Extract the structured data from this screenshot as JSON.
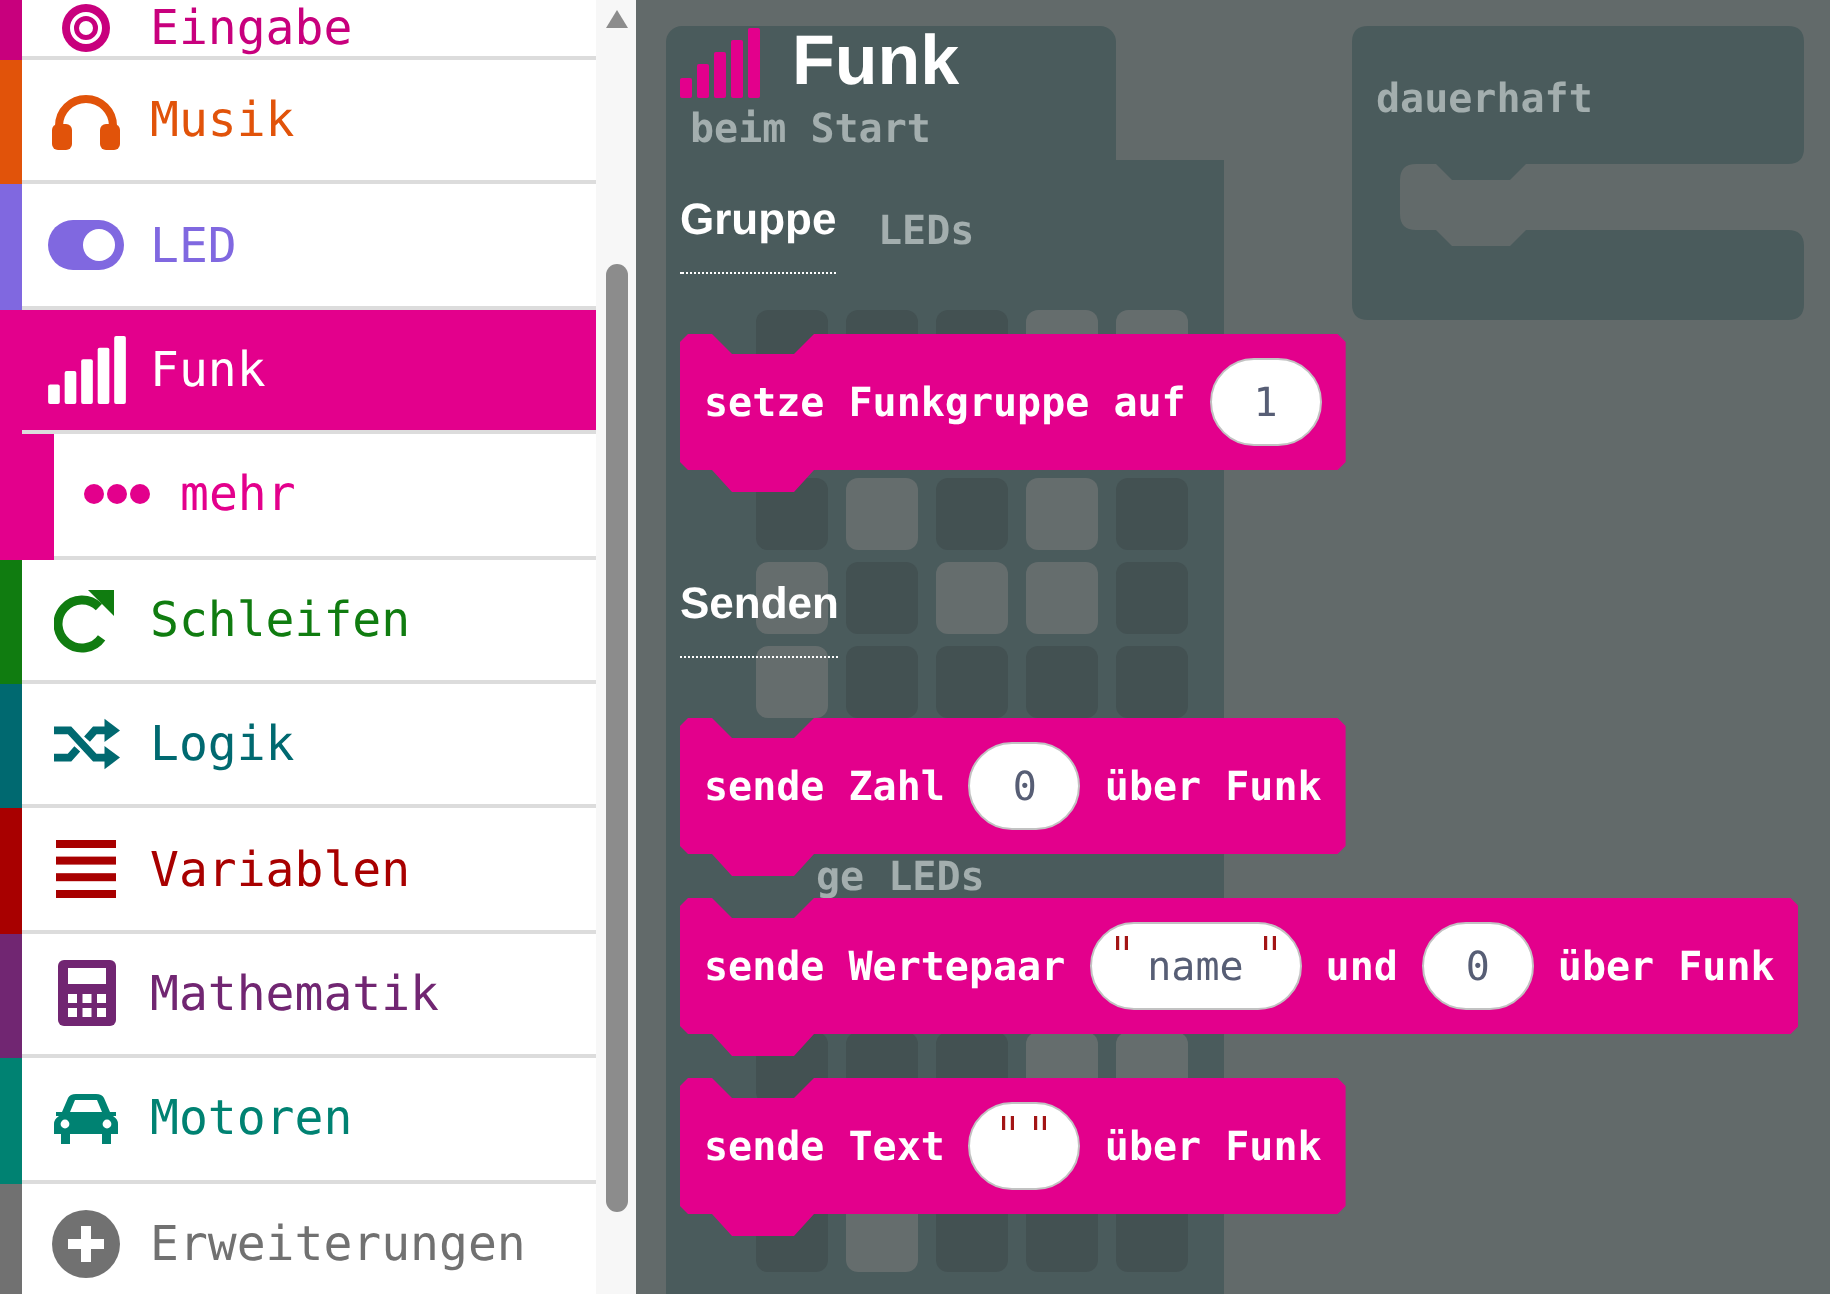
{
  "sidebar": {
    "items": [
      {
        "label": "Eingabe",
        "color": "#c8007d",
        "selected": false
      },
      {
        "label": "Musik",
        "color": "#e1530a",
        "selected": false
      },
      {
        "label": "LED",
        "color": "#8068e0",
        "selected": false
      },
      {
        "label": "Funk",
        "color": "#e3008c",
        "selected": true,
        "children": [
          {
            "label": "mehr",
            "color": "#e3008c",
            "selected": false
          }
        ]
      },
      {
        "label": "Schleifen",
        "color": "#107c10",
        "selected": false
      },
      {
        "label": "Logik",
        "color": "#006970",
        "selected": false
      },
      {
        "label": "Variablen",
        "color": "#a80000",
        "selected": false
      },
      {
        "label": "Mathematik",
        "color": "#712672",
        "selected": false
      },
      {
        "label": "Motoren",
        "color": "#008272",
        "selected": false
      },
      {
        "label": "Erweiterungen",
        "color": "#717171",
        "selected": false
      }
    ]
  },
  "workspace": {
    "blocks": [
      {
        "kind": "hat",
        "label": "beim Start"
      },
      {
        "kind": "leds",
        "label": "LEDs",
        "rows": [
          {
            "cells": [
              {
                "on": false
              },
              {
                "on": false
              },
              {
                "on": false
              },
              {
                "on": true
              },
              {
                "on": true
              }
            ]
          },
          {
            "cells": [
              {
                "on": false
              },
              {
                "on": true
              },
              {
                "on": false
              },
              {
                "on": true
              },
              {
                "on": false
              }
            ]
          },
          {
            "cells": [
              {
                "on": true
              },
              {
                "on": false
              },
              {
                "on": true
              },
              {
                "on": true
              },
              {
                "on": false
              }
            ]
          },
          {
            "cells": [
              {
                "on": true
              },
              {
                "on": false
              },
              {
                "on": false
              },
              {
                "on": false
              },
              {
                "on": false
              }
            ]
          }
        ]
      },
      {
        "kind": "leds",
        "label": "ge LEDs",
        "rows": [
          {
            "cells": [
              {
                "on": false
              },
              {
                "on": false
              },
              {
                "on": false
              },
              {
                "on": true
              },
              {
                "on": true
              }
            ]
          },
          {
            "cells": [
              {
                "on": false
              },
              {
                "on": true
              },
              {
                "on": false
              },
              {
                "on": false
              },
              {
                "on": false
              }
            ]
          }
        ]
      },
      {
        "kind": "forever",
        "label": "dauerhaft"
      }
    ]
  },
  "flyout": {
    "title": "Funk",
    "sections": [
      {
        "heading": "Gruppe",
        "blocks": [
          {
            "parts": [
              {
                "kind": "label",
                "text": "setze Funkgruppe auf"
              },
              {
                "kind": "number",
                "value": "1"
              }
            ]
          }
        ]
      },
      {
        "heading": "Senden",
        "blocks": [
          {
            "parts": [
              {
                "kind": "label",
                "text": "sende Zahl"
              },
              {
                "kind": "number",
                "value": "0"
              },
              {
                "kind": "label",
                "text": "über Funk"
              }
            ]
          },
          {
            "parts": [
              {
                "kind": "label",
                "text": "sende Wertepaar"
              },
              {
                "kind": "text",
                "value": "name"
              },
              {
                "kind": "label",
                "text": "und"
              },
              {
                "kind": "number",
                "value": "0"
              },
              {
                "kind": "label",
                "text": "über Funk"
              }
            ]
          },
          {
            "parts": [
              {
                "kind": "label",
                "text": "sende Text"
              },
              {
                "kind": "text"
              },
              {
                "kind": "label",
                "text": "über Funk"
              }
            ]
          }
        ]
      }
    ]
  }
}
